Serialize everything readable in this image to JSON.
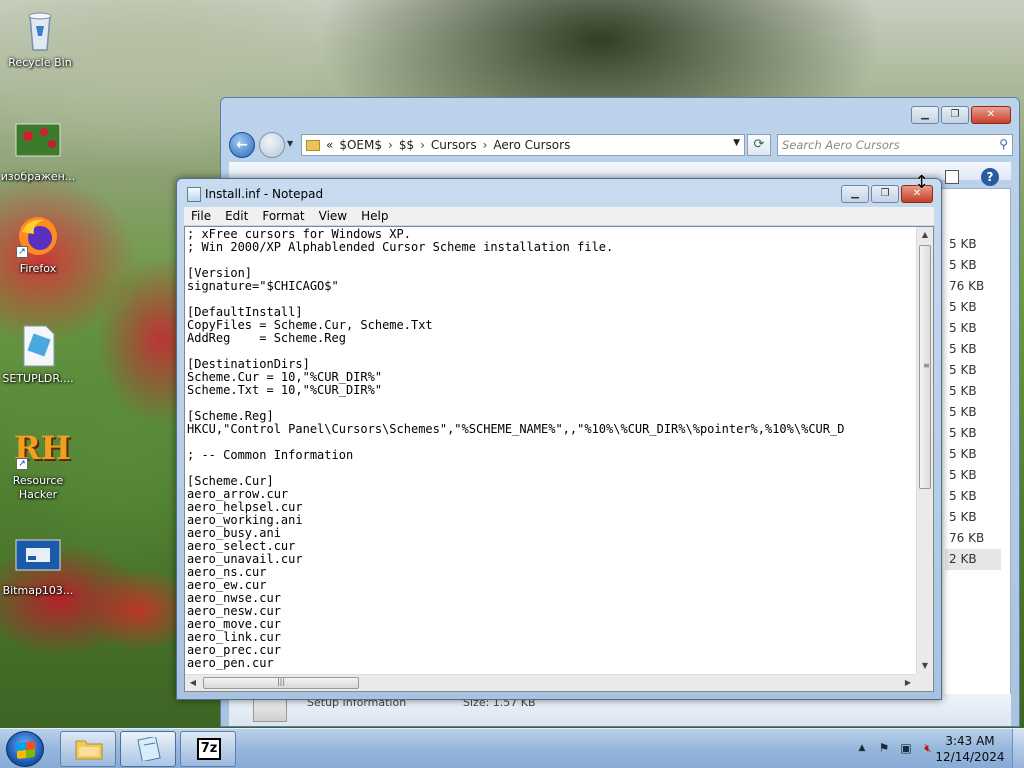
{
  "desktop": {
    "icons": [
      {
        "label": "Recycle Bin",
        "icon": "recycle-bin-icon"
      },
      {
        "label": "изображен...",
        "icon": "image-file-icon"
      },
      {
        "label": "Firefox",
        "icon": "firefox-icon"
      },
      {
        "label": "SETUPLDR....",
        "icon": "setup-file-icon"
      },
      {
        "label": "Resource Hacker",
        "icon": "resource-hacker-icon",
        "glyph": "RH"
      },
      {
        "label": "Bitmap103...",
        "icon": "bitmap-file-icon"
      }
    ]
  },
  "explorer": {
    "nav_back": "←",
    "address": {
      "prefix": "«",
      "crumbs": [
        "$OEM$",
        "$$",
        "Cursors",
        "Aero Cursors"
      ],
      "separator": "›"
    },
    "search_placeholder": "Search Aero Cursors",
    "sizes": [
      "5 KB",
      "5 KB",
      "76 KB",
      "5 KB",
      "5 KB",
      "5 KB",
      "5 KB",
      "5 KB",
      "5 KB",
      "5 KB",
      "5 KB",
      "5 KB",
      "5 KB",
      "5 KB",
      "76 KB",
      "2 KB"
    ],
    "status_type": "Setup Information",
    "status_size": "Size: 1.57 KB"
  },
  "notepad": {
    "title": "Install.inf - Notepad",
    "menu": [
      "File",
      "Edit",
      "Format",
      "View",
      "Help"
    ],
    "content": "; xFree cursors for Windows XP.\n; Win 2000/XP Alphablended Cursor Scheme installation file.\n\n[Version]\nsignature=\"$CHICAGO$\"\n\n[DefaultInstall]\nCopyFiles = Scheme.Cur, Scheme.Txt\nAddReg    = Scheme.Reg\n\n[DestinationDirs]\nScheme.Cur = 10,\"%CUR_DIR%\"\nScheme.Txt = 10,\"%CUR_DIR%\"\n\n[Scheme.Reg]\nHKCU,\"Control Panel\\Cursors\\Schemes\",\"%SCHEME_NAME%\",,\"%10%\\%CUR_DIR%\\%pointer%,%10%\\%CUR_D\n\n; -- Common Information\n\n[Scheme.Cur]\naero_arrow.cur\naero_helpsel.cur\naero_working.ani\naero_busy.ani\naero_select.cur\naero_unavail.cur\naero_ns.cur\naero_ew.cur\naero_nwse.cur\naero_nesw.cur\naero_move.cur\naero_link.cur\naero_prec.cur\naero_pen.cur"
  },
  "taskbar": {
    "apps": [
      {
        "name": "windows-explorer",
        "icon": "folder-icon"
      },
      {
        "name": "notepad",
        "icon": "notepad-icon"
      },
      {
        "name": "7-zip",
        "icon": "7zip-icon",
        "glyph": "7z"
      }
    ],
    "clock_time": "3:43 AM",
    "clock_date": "12/14/2024"
  }
}
